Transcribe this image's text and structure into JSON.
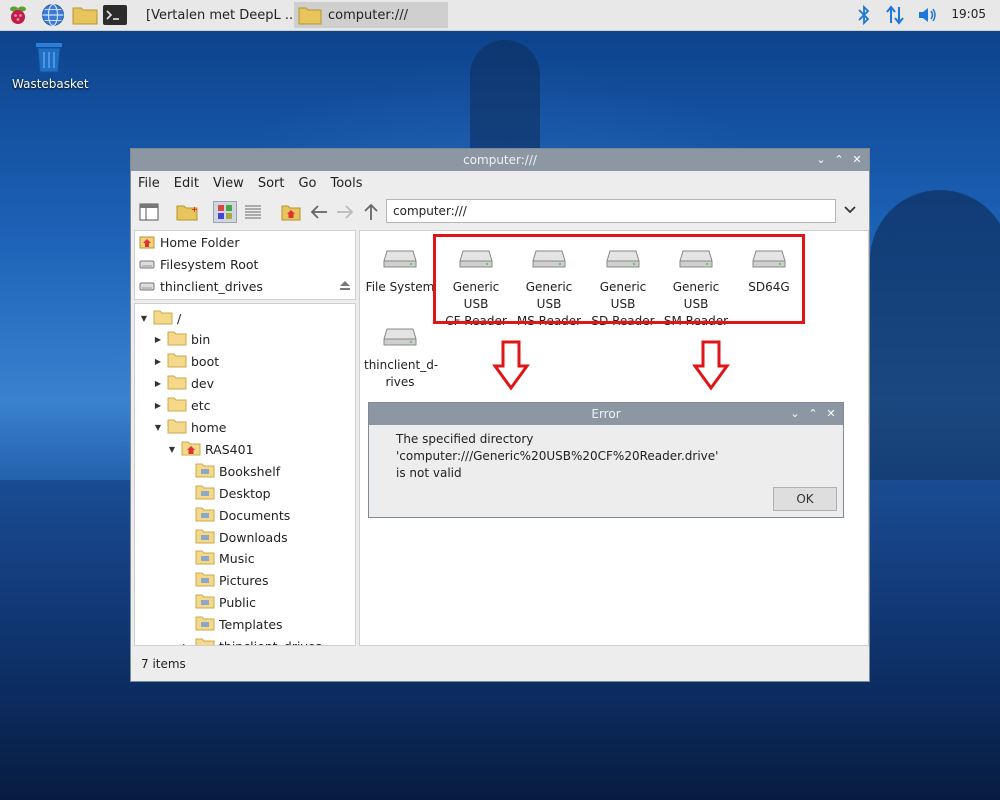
{
  "taskbar": {
    "tasks": [
      {
        "label": "[Vertalen met DeepL ..."
      },
      {
        "label": "computer:///"
      }
    ],
    "clock": "19:05"
  },
  "desktop": {
    "trash_label": "Wastebasket"
  },
  "window": {
    "title": "computer:///",
    "menu": [
      "File",
      "Edit",
      "View",
      "Sort",
      "Go",
      "Tools"
    ],
    "address": "computer:///",
    "places": [
      {
        "label": "Home Folder",
        "icon": "home-folder-icon"
      },
      {
        "label": "Filesystem Root",
        "icon": "drive-icon"
      },
      {
        "label": "thinclient_drives",
        "icon": "drive-icon"
      }
    ],
    "tree": [
      {
        "label": "/",
        "level": 0,
        "expanded": true
      },
      {
        "label": "bin",
        "level": 1,
        "expanded": false
      },
      {
        "label": "boot",
        "level": 1,
        "expanded": false
      },
      {
        "label": "dev",
        "level": 1,
        "expanded": false
      },
      {
        "label": "etc",
        "level": 1,
        "expanded": false
      },
      {
        "label": "home",
        "level": 1,
        "expanded": true
      },
      {
        "label": "RAS401",
        "level": 2,
        "expanded": true
      },
      {
        "label": "Bookshelf",
        "level": 3
      },
      {
        "label": "Desktop",
        "level": 3
      },
      {
        "label": "Documents",
        "level": 3
      },
      {
        "label": "Downloads",
        "level": 3
      },
      {
        "label": "Music",
        "level": 3
      },
      {
        "label": "Pictures",
        "level": 3
      },
      {
        "label": "Public",
        "level": 3
      },
      {
        "label": "Templates",
        "level": 3
      },
      {
        "label": "thinclient_drives",
        "level": 3,
        "expanded": false
      }
    ],
    "devices": [
      {
        "line1": "File System",
        "line2": ""
      },
      {
        "line1": "Generic USB",
        "line2": "CF Reader"
      },
      {
        "line1": "Generic USB",
        "line2": "MS Reader"
      },
      {
        "line1": "Generic USB",
        "line2": "SD Reader"
      },
      {
        "line1": "Generic USB",
        "line2": "SM Reader"
      },
      {
        "line1": "SD64G",
        "line2": ""
      },
      {
        "line1": "thinclient_d-",
        "line2": "rives"
      }
    ],
    "status": "7 items"
  },
  "dialog": {
    "title": "Error",
    "message_line1": "The specified directory 'computer:///Generic%20USB%20CF%20Reader.drive'",
    "message_line2": "is not valid",
    "ok_label": "OK"
  },
  "colors": {
    "highlight": "#e01515",
    "titlebar": "#8d97a3",
    "folder": "#f2c94c"
  }
}
